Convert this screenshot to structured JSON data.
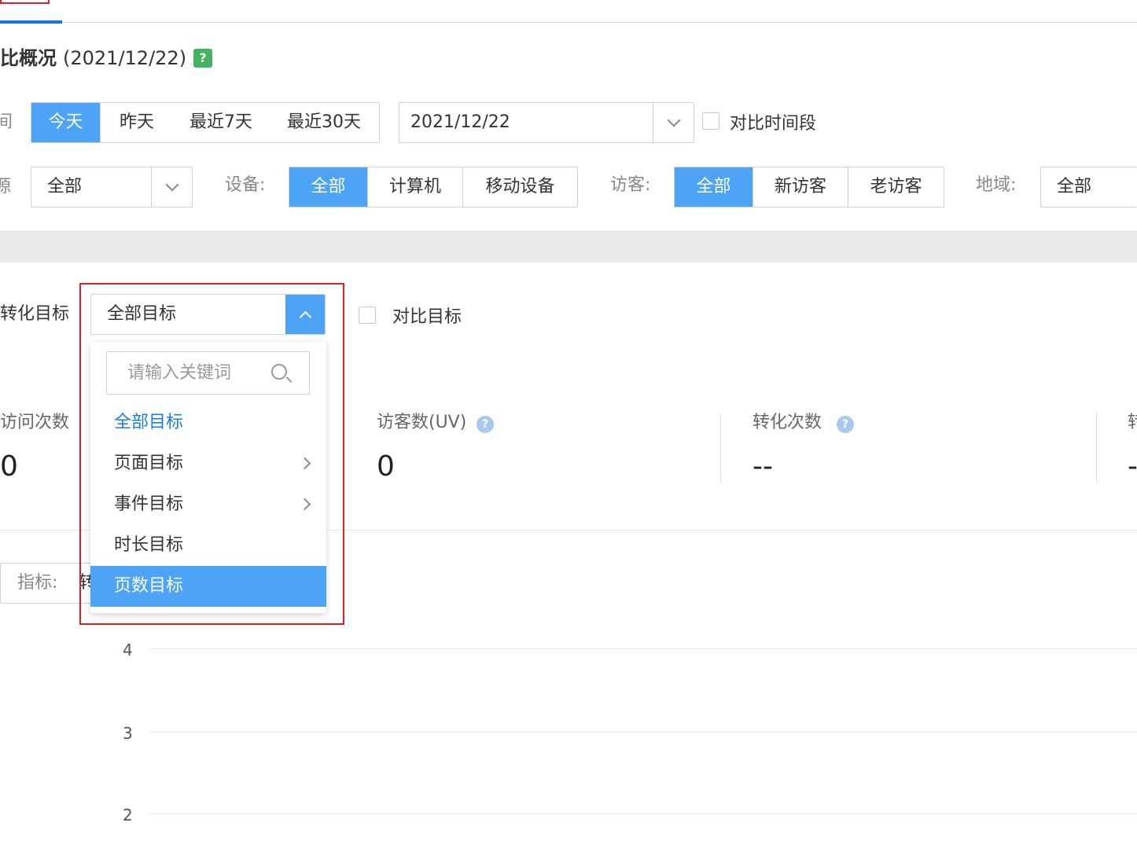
{
  "header": {
    "title_main": "比概况",
    "title_date": "(2021/12/22)",
    "help_icon": "?"
  },
  "filters": {
    "time_label_fragment": "间:",
    "time_ranges": [
      "今天",
      "昨天",
      "最近7天",
      "最近30天"
    ],
    "time_active": "今天",
    "date_value": "2021/12/22",
    "compare_period_label": "对比时间段",
    "source_label_fragment": "源:",
    "source_value": "全部",
    "device_label": "设备:",
    "devices": [
      "全部",
      "计算机",
      "移动设备"
    ],
    "visitor_label": "访客:",
    "visitors": [
      "全部",
      "新访客",
      "老访客"
    ],
    "region_label": "地域:",
    "region_value": "全部"
  },
  "goal": {
    "label": "转化目标",
    "selected": "全部目标",
    "compare_label": "对比目标",
    "dropdown": {
      "search_placeholder": "请输入关键词",
      "items": [
        "全部目标",
        "页面目标",
        "事件目标",
        "时长目标",
        "页数目标"
      ],
      "current": "全部目标",
      "highlighted": "页数目标"
    }
  },
  "metrics": [
    {
      "label": "访问次数",
      "value": "0"
    },
    {
      "label": "访客数(UV)",
      "value": "0"
    },
    {
      "label": "转化次数",
      "value": "--"
    },
    {
      "label": "转",
      "value": "-"
    }
  ],
  "indicator": {
    "label": "指标:",
    "value_fragment": "转"
  },
  "chart_data": {
    "type": "line",
    "y_ticks": [
      "4",
      "3",
      "2"
    ],
    "series": []
  },
  "colors": {
    "accent": "#4da3f5",
    "highlight_frame": "#e02020",
    "help_green": "#43b363"
  }
}
